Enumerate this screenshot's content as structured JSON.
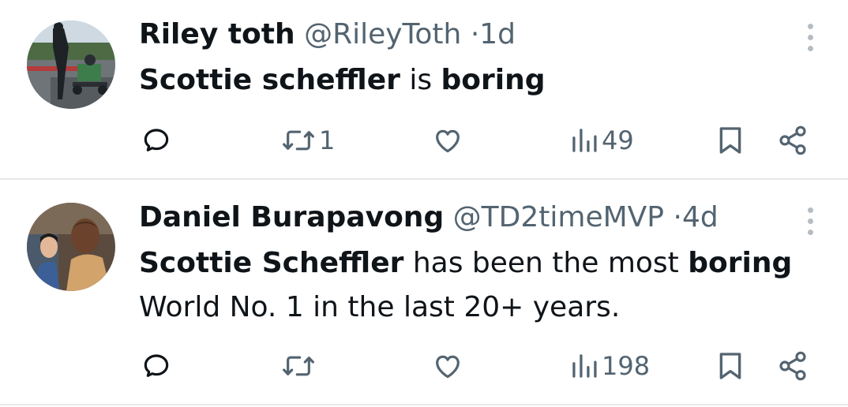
{
  "tweets": [
    {
      "author_name": "Riley toth",
      "handle": "@RileyToth",
      "separator": "·",
      "time": "1d",
      "text_parts": [
        {
          "text": "Scottie scheffler",
          "bold": true
        },
        {
          "text": " is ",
          "bold": false
        },
        {
          "text": "boring",
          "bold": true
        }
      ],
      "stats": {
        "reply": "",
        "retweet": "1",
        "like": "",
        "views": "49"
      },
      "avatar_icon": "person-on-racetrack-photo"
    },
    {
      "author_name": "Daniel Burapavong",
      "handle": "@TD2timeMVP",
      "separator": "·",
      "time": "4d",
      "text_parts": [
        {
          "text": "Scottie Scheffler",
          "bold": true
        },
        {
          "text": " has been the most ",
          "bold": false
        },
        {
          "text": "boring",
          "bold": true
        },
        {
          "text": " World No. 1 in the last 20+ years.",
          "bold": false
        }
      ],
      "stats": {
        "reply": "",
        "retweet": "",
        "like": "",
        "views": "198"
      },
      "avatar_icon": "two-people-photo"
    }
  ],
  "colors": {
    "text": "#0f1419",
    "secondary": "#536471",
    "divider": "#e7e9ea",
    "more_dots": "#b5bcc3"
  }
}
